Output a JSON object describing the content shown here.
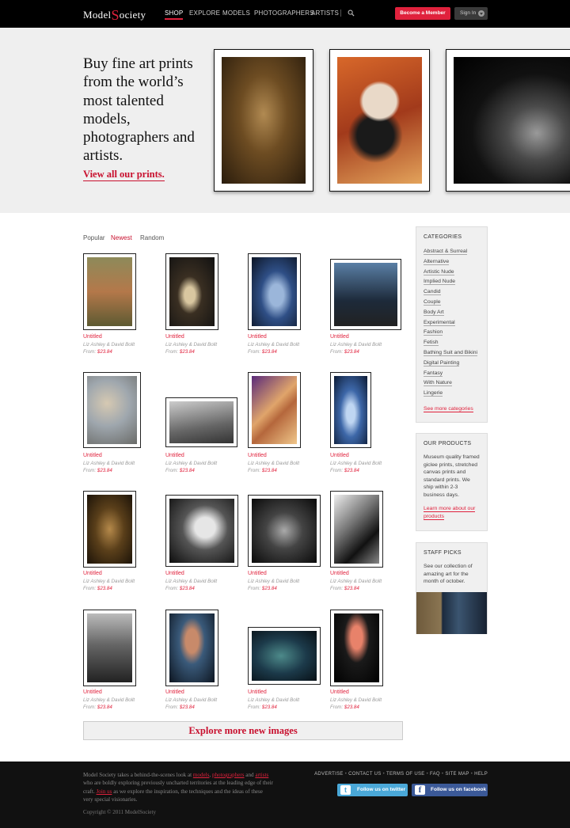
{
  "brand": {
    "pre": "Model",
    "s": "S",
    "post": "ociety"
  },
  "nav": {
    "items": [
      "SHOP",
      "EXPLORE",
      "MODELS",
      "PHOTOGRAPHERS",
      "ARTISTS"
    ],
    "member": "Become a Member",
    "signin": "Sign In"
  },
  "hero": {
    "title": "Buy fine art prints from the world’s most talented models, photographers and artists.",
    "link": "View all our prints."
  },
  "tabs": [
    "Popular",
    "Newest",
    "Random"
  ],
  "item": {
    "title": "Untitled",
    "artist": "Liz Ashley & David Bollt",
    "price_prefix": "From: ",
    "price": "$23.84"
  },
  "explore": "Explore more new images",
  "categories": {
    "heading": "CATEGORIES",
    "items": [
      "Abstract & Surreal",
      "Alternative",
      "Artistic Nude",
      "Implied Nude",
      "Candid",
      "Couple",
      "Body Art",
      "Experimental",
      "Fashion",
      "Fetish",
      "Bathing Suit and Bikini",
      "Digital Painting",
      "Fantasy",
      "With Nature",
      "Lingerie"
    ],
    "more": "See more categories"
  },
  "products": {
    "heading": "OUR PRODUCTS",
    "text": "Museum quality framed giclee prints, stretched canvas prints and standard prints. We ship within 2-3 business days.",
    "link": "Learn more about our products"
  },
  "staff": {
    "heading": "STAFF PICKS",
    "text": "See our collection of amazing art for the month of october."
  },
  "footer": {
    "p1": "Model Society takes a behind-the-scenes look at ",
    "models": "models",
    "comma": ", ",
    "photographers": "photographers",
    "and": " and ",
    "artists": "artists",
    "p2": " who are boldly exploring previously uncharted territories at the leading edge of their craft. ",
    "join": "Join us",
    "p3": " as we explore the inspiration, the techniques and the ideas of these very special visionaries.",
    "copyright": "Copyright © 2011 ModelSociety",
    "links": [
      "ADVERTISE",
      "CONTACT US",
      "TERMS OF USE",
      "FAQ",
      "SITE MAP",
      "HELP"
    ],
    "twitter": "Follow us on twitter",
    "facebook": "Follow us on facebook"
  }
}
